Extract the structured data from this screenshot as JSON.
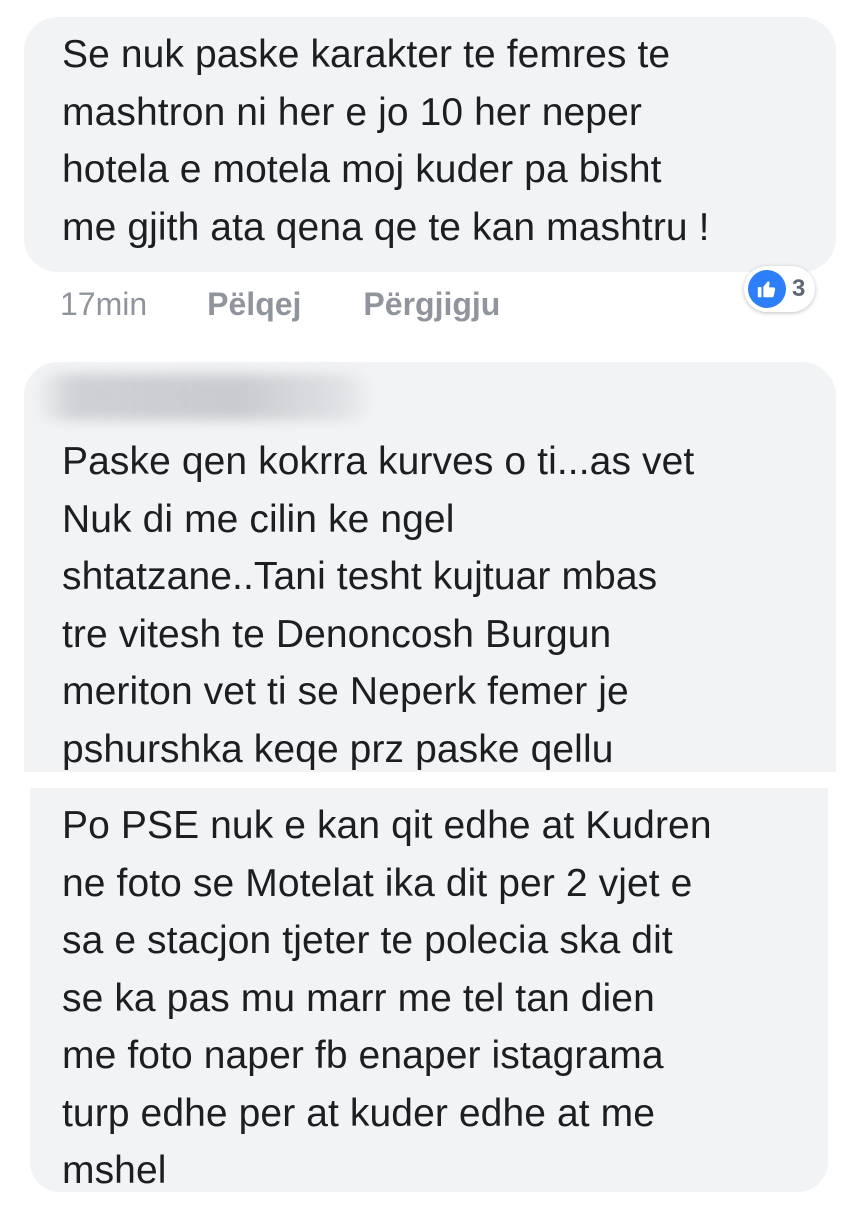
{
  "comments": [
    {
      "text": "Se nuk paske karakter te femres te\nmashtron ni her e jo 10 her neper\nhotela e motela moj kuder pa bisht\nme gjith ata qena qe te kan mashtru !",
      "timestamp": "17min",
      "like_label": "Pëlqej",
      "reply_label": "Përgjigju",
      "reaction_count": "3",
      "reaction_icon": "like-icon",
      "reaction_color": "#2d7ff9"
    },
    {
      "text": "Paske qen kokrra kurves o ti...as vet\nNuk di me cilin ke ngel\nshtatzane..Tani tesht kujtuar mbas\ntre vitesh te Denoncosh  Burgun\nmeriton vet ti se Neperk femer je\npshurshka keqe prz paske qellu"
    },
    {
      "text": "Po PSE  nuk e kan qit edhe at Kudren\nne foto se Motelat ika dit per 2 vjet e\nsa e stacjon tjeter te polecia ska dit\nse ka pas mu marr me tel tan dien\nme foto naper fb enaper istagrama\nturp edhe per at kuder edhe at me\nmshel"
    }
  ],
  "colors": {
    "bubble": "#f2f3f5",
    "text": "#1c1e21",
    "meta": "#90949c"
  }
}
